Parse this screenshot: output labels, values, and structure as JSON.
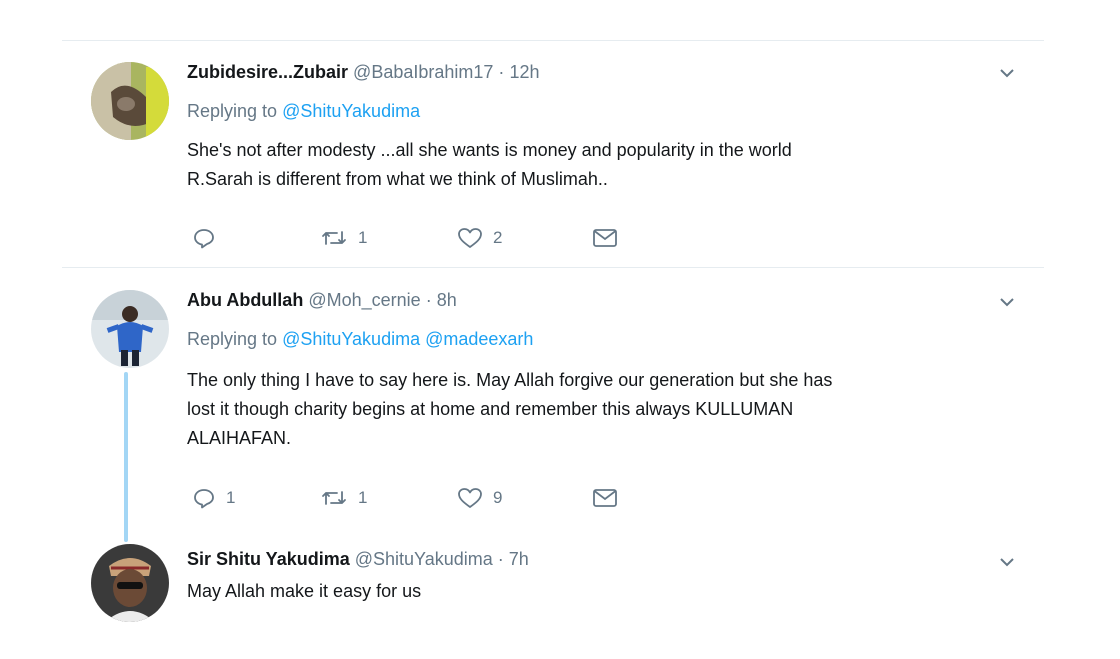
{
  "tweets": [
    {
      "name": "Zubidesire...Zubair",
      "handle": "@BabaIbrahim17",
      "time": "12h",
      "replying_label": "Replying to",
      "mentions": [
        "@ShituYakudima"
      ],
      "lines": [
        "She's not after modesty ...all she wants is money and popularity in the world",
        "R.Sarah is different from what we think of Muslimah.."
      ],
      "actions": {
        "reply": "",
        "retweet": "1",
        "like": "2"
      }
    },
    {
      "name": "Abu Abdullah",
      "handle": "@Moh_cernie",
      "time": "8h",
      "replying_label": "Replying to",
      "mentions": [
        "@ShituYakudima",
        "@madeexarh"
      ],
      "lines": [
        "The only thing I have to say here is. May Allah forgive our generation but she has",
        "lost it though charity begins at home and remember this always KULLUMAN",
        "ALAIHAFAN."
      ],
      "actions": {
        "reply": "1",
        "retweet": "1",
        "like": "9"
      }
    },
    {
      "name": "Sir Shitu Yakudima",
      "handle": "@ShituYakudima",
      "time": "7h",
      "lines": [
        "May Allah make it easy for us"
      ]
    }
  ],
  "separator": "·",
  "colors": {
    "link": "#1da1f2",
    "muted": "#657786",
    "thread_line": "#a3d6f5"
  },
  "icons": [
    "reply-icon",
    "retweet-icon",
    "like-icon",
    "direct-message-icon",
    "chevron-down-icon"
  ]
}
